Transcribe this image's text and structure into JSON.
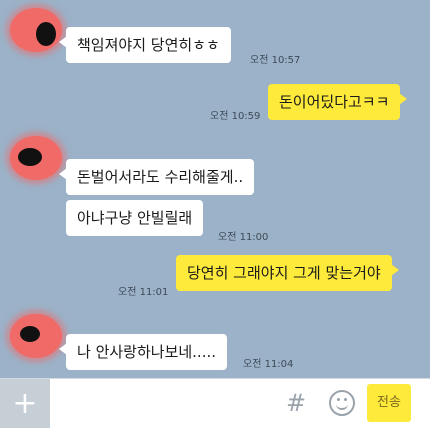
{
  "messages": [
    {
      "text": "책임져야지 당연히ㅎㅎ",
      "time": "오전 10:57"
    },
    {
      "text": "돈이어딨다고ㅋㅋ",
      "time": "오전 10:59"
    },
    {
      "text": "돈벌어서라도 수리해줄게.."
    },
    {
      "text": "아냐구냥 안빌릴래",
      "time": "오전 11:00"
    },
    {
      "text": "당연히 그래야지 그게 맞는거야",
      "time": "오전 11:01"
    },
    {
      "text": "나 안사랑하나보네.....",
      "time": "오전 11:04"
    }
  ],
  "input_bar": {
    "plus_symbol": "+",
    "input_value": "",
    "hash_symbol": "#",
    "send_label": "전송"
  },
  "icons": [
    "profile-avatar",
    "plus-icon",
    "hash-icon",
    "emoticon-icon"
  ],
  "colors": {
    "background": "#9bb2c8",
    "incoming_bubble": "#ffffff",
    "outgoing_bubble": "#fdea3a",
    "send_button": "#fdea3a"
  }
}
